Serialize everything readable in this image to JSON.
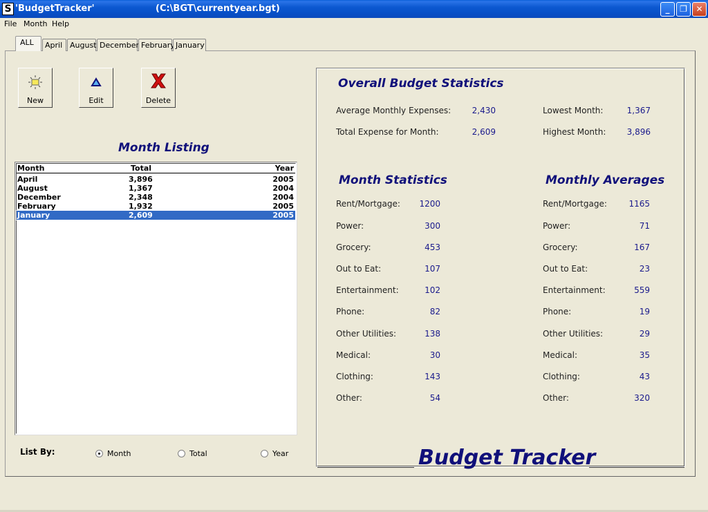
{
  "window": {
    "title": "'BudgetTracker'",
    "path": "(C:\\BGT\\currentyear.bgt)",
    "icon_text": "S",
    "minimize_label": "_",
    "maximize_label": "❐",
    "close_label": "✕"
  },
  "menu": [
    "File",
    "Month",
    "Help"
  ],
  "tabs": [
    "ALL",
    "April",
    "August",
    "December",
    "February",
    "January"
  ],
  "toolbar": {
    "new_label": "New",
    "edit_label": "Edit",
    "delete_label": "Delete"
  },
  "listing": {
    "title": "Month Listing",
    "columns": [
      "Month",
      "Total",
      "Year"
    ],
    "rows": [
      {
        "month": "April",
        "total": "3,896",
        "year": "2005"
      },
      {
        "month": "August",
        "total": "1,367",
        "year": "2004"
      },
      {
        "month": "December",
        "total": "2,348",
        "year": "2004"
      },
      {
        "month": "February",
        "total": "1,932",
        "year": "2005"
      },
      {
        "month": "January",
        "total": "2,609",
        "year": "2005"
      }
    ],
    "selected": "January"
  },
  "list_by": {
    "label": "List By:",
    "options": [
      "Month",
      "Total",
      "Year"
    ],
    "selected": "Month"
  },
  "overall": {
    "title": "Overall Budget Statistics",
    "avg_label": "Average Monthly Expenses:",
    "avg_value": "2,430",
    "total_label": "Total Expense for Month:",
    "total_value": "2,609",
    "lowest_label": "Lowest Month:",
    "lowest_value": "1,367",
    "highest_label": "Highest Month:",
    "highest_value": "3,896"
  },
  "month_stats": {
    "title": "Month Statistics",
    "items": [
      {
        "label": "Rent/Mortgage:",
        "value": "1200"
      },
      {
        "label": "Power:",
        "value": "300"
      },
      {
        "label": "Grocery:",
        "value": "453"
      },
      {
        "label": "Out to Eat:",
        "value": "107"
      },
      {
        "label": "Entertainment:",
        "value": "102"
      },
      {
        "label": "Phone:",
        "value": "82"
      },
      {
        "label": "Other Utilities:",
        "value": "138"
      },
      {
        "label": "Medical:",
        "value": "30"
      },
      {
        "label": "Clothing:",
        "value": "143"
      },
      {
        "label": "Other:",
        "value": "54"
      }
    ]
  },
  "monthly_averages": {
    "title": "Monthly Averages",
    "items": [
      {
        "label": "Rent/Mortgage:",
        "value": "1165"
      },
      {
        "label": "Power:",
        "value": "71"
      },
      {
        "label": "Grocery:",
        "value": "167"
      },
      {
        "label": "Out to Eat:",
        "value": "23"
      },
      {
        "label": "Entertainment:",
        "value": "559"
      },
      {
        "label": "Phone:",
        "value": "19"
      },
      {
        "label": "Other Utilities:",
        "value": "29"
      },
      {
        "label": "Medical:",
        "value": "35"
      },
      {
        "label": "Clothing:",
        "value": "43"
      },
      {
        "label": "Other:",
        "value": "320"
      }
    ]
  },
  "brand": "Budget Tracker",
  "colors": {
    "accent": "#10107A",
    "value_text": "#1A1A8C",
    "selection": "#316AC5"
  }
}
